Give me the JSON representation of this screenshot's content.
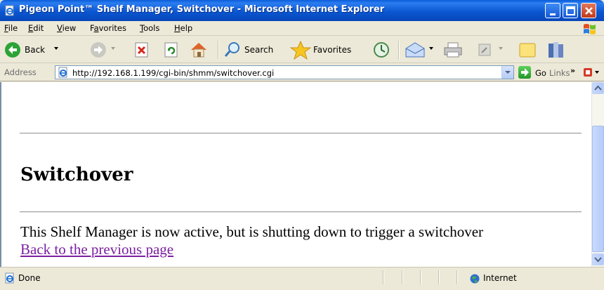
{
  "window": {
    "title": "Pigeon Point™ Shelf Manager, Switchover - Microsoft Internet Explorer"
  },
  "menu": {
    "items": [
      {
        "label": "File",
        "accel": "F",
        "rest": "ile"
      },
      {
        "label": "Edit",
        "accel": "E",
        "rest": "dit"
      },
      {
        "label": "View",
        "accel": "V",
        "rest": "iew"
      },
      {
        "label": "Favorites",
        "pre": "F",
        "accel": "a",
        "rest": "vorites"
      },
      {
        "label": "Tools",
        "accel": "T",
        "rest": "ools"
      },
      {
        "label": "Help",
        "accel": "H",
        "rest": "elp"
      }
    ]
  },
  "toolbar": {
    "back_label": "Back",
    "search_label": "Search",
    "favorites_label": "Favorites"
  },
  "address": {
    "label": "Address",
    "url": "http://192.168.1.199/cgi-bin/shmm/switchover.cgi",
    "go_label": "Go",
    "links_label": "Links"
  },
  "page": {
    "heading": "Switchover",
    "message": "This Shelf Manager is now active, but is shutting down to trigger a switchover",
    "link_text": "Back to the previous page"
  },
  "status": {
    "text": "Done",
    "zone": "Internet"
  },
  "colors": {
    "titlebar": "#0a57d2",
    "visited_link": "#7b1fa2",
    "page_bg": "#ffffff"
  }
}
